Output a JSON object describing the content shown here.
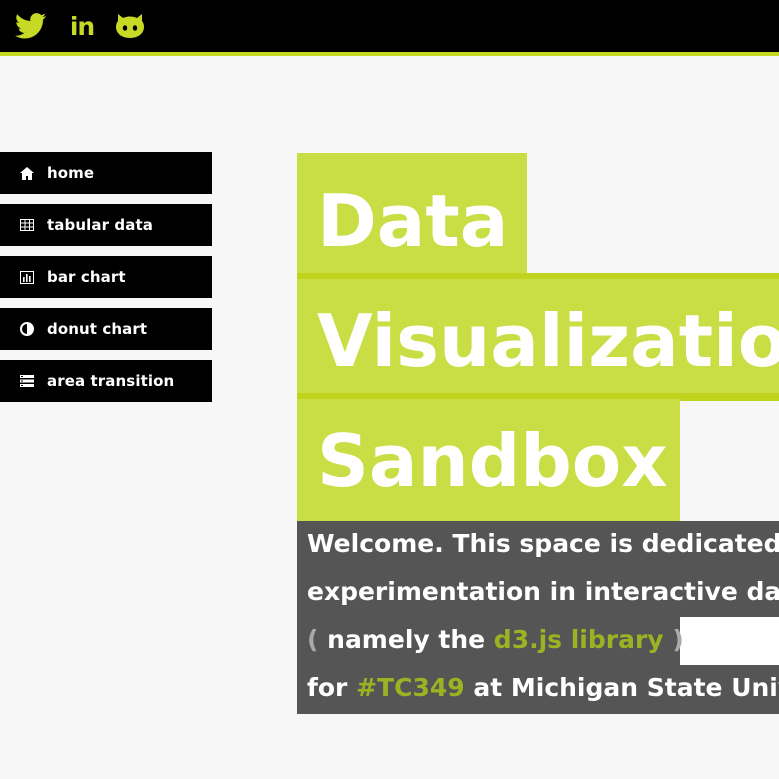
{
  "topbar": {
    "social": [
      {
        "name": "twitter-icon"
      },
      {
        "name": "linkedin-icon",
        "label": "in"
      },
      {
        "name": "github-icon"
      }
    ]
  },
  "nav": {
    "items": [
      {
        "label": "home",
        "icon": "home-icon"
      },
      {
        "label": "tabular data",
        "icon": "table-icon"
      },
      {
        "label": "bar chart",
        "icon": "bar-chart-icon"
      },
      {
        "label": "donut chart",
        "icon": "half-circle-icon"
      },
      {
        "label": "area transition",
        "icon": "list-icon"
      }
    ]
  },
  "title": {
    "line1": "Data",
    "line2": "Visualization",
    "line3": "Sandbox"
  },
  "welcome": {
    "line1": "Welcome. This space is dedicated to",
    "line2": "experimentation in interactive data",
    "line3_open": "(",
    "line3_text": " namely the ",
    "line3_link": "d3.js library",
    "line3_close": " )",
    "line4_pre": "for ",
    "line4_tag": "#TC349",
    "line4_post": " at Michigan State University"
  },
  "colors": {
    "accent": "#c9dd44",
    "topbar": "#000000",
    "welcome_bg": "#555555"
  }
}
